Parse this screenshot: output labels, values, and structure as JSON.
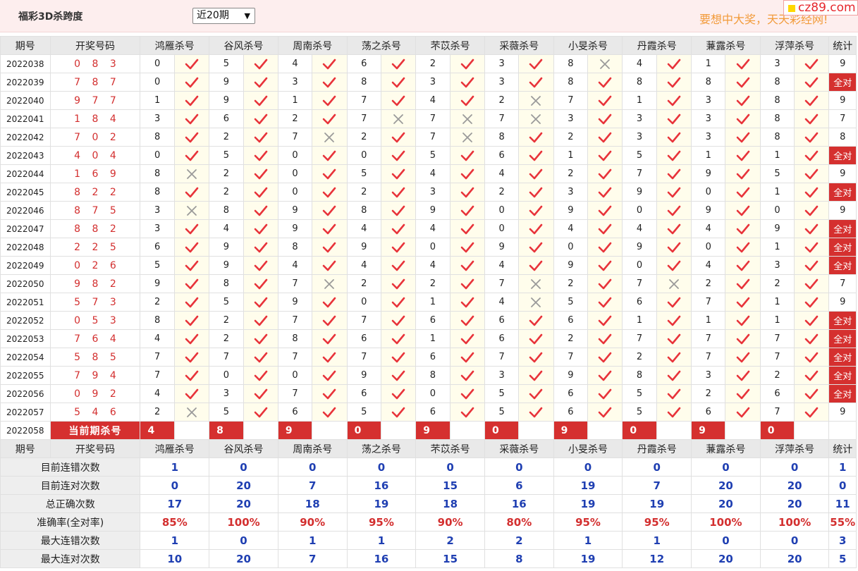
{
  "header": {
    "title": "福彩3D杀跨度",
    "period_select": "近20期",
    "slogan": "要想中大奖，天天彩经网!",
    "site_badge": "cz89.com"
  },
  "table": {
    "headers": [
      "期号",
      "开奖号码",
      "鸿雁杀号",
      "谷风杀号",
      "周南杀号",
      "荡之杀号",
      "芣苡杀号",
      "采薇杀号",
      "小旻杀号",
      "丹霞杀号",
      "蒹露杀号",
      "浮萍杀号",
      "统计"
    ],
    "all_correct_label": "全对",
    "rows": [
      {
        "period": "2022038",
        "draw": "0 8 3",
        "picks": [
          [
            0,
            1
          ],
          [
            5,
            1
          ],
          [
            4,
            1
          ],
          [
            6,
            1
          ],
          [
            2,
            1
          ],
          [
            3,
            1
          ],
          [
            8,
            0
          ],
          [
            4,
            1
          ],
          [
            1,
            1
          ],
          [
            3,
            1
          ]
        ],
        "stat": "9"
      },
      {
        "period": "2022039",
        "draw": "7 8 7",
        "picks": [
          [
            0,
            1
          ],
          [
            9,
            1
          ],
          [
            3,
            1
          ],
          [
            8,
            1
          ],
          [
            3,
            1
          ],
          [
            3,
            1
          ],
          [
            8,
            1
          ],
          [
            8,
            1
          ],
          [
            8,
            1
          ],
          [
            8,
            1
          ]
        ],
        "stat": "全对"
      },
      {
        "period": "2022040",
        "draw": "9 7 7",
        "picks": [
          [
            1,
            1
          ],
          [
            9,
            1
          ],
          [
            1,
            1
          ],
          [
            7,
            1
          ],
          [
            4,
            1
          ],
          [
            2,
            0
          ],
          [
            7,
            1
          ],
          [
            1,
            1
          ],
          [
            3,
            1
          ],
          [
            8,
            1
          ]
        ],
        "stat": "9"
      },
      {
        "period": "2022041",
        "draw": "1 8 4",
        "picks": [
          [
            3,
            1
          ],
          [
            6,
            1
          ],
          [
            2,
            1
          ],
          [
            7,
            0
          ],
          [
            7,
            0
          ],
          [
            7,
            0
          ],
          [
            3,
            1
          ],
          [
            3,
            1
          ],
          [
            3,
            1
          ],
          [
            8,
            1
          ]
        ],
        "stat": "7"
      },
      {
        "period": "2022042",
        "draw": "7 0 2",
        "picks": [
          [
            8,
            1
          ],
          [
            2,
            1
          ],
          [
            7,
            0
          ],
          [
            2,
            1
          ],
          [
            7,
            0
          ],
          [
            8,
            1
          ],
          [
            2,
            1
          ],
          [
            3,
            1
          ],
          [
            3,
            1
          ],
          [
            8,
            1
          ]
        ],
        "stat": "8"
      },
      {
        "period": "2022043",
        "draw": "4 0 4",
        "picks": [
          [
            0,
            1
          ],
          [
            5,
            1
          ],
          [
            0,
            1
          ],
          [
            0,
            1
          ],
          [
            5,
            1
          ],
          [
            6,
            1
          ],
          [
            1,
            1
          ],
          [
            5,
            1
          ],
          [
            1,
            1
          ],
          [
            1,
            1
          ]
        ],
        "stat": "全对"
      },
      {
        "period": "2022044",
        "draw": "1 6 9",
        "picks": [
          [
            8,
            0
          ],
          [
            2,
            1
          ],
          [
            0,
            1
          ],
          [
            5,
            1
          ],
          [
            4,
            1
          ],
          [
            4,
            1
          ],
          [
            2,
            1
          ],
          [
            7,
            1
          ],
          [
            9,
            1
          ],
          [
            5,
            1
          ]
        ],
        "stat": "9"
      },
      {
        "period": "2022045",
        "draw": "8 2 2",
        "picks": [
          [
            8,
            1
          ],
          [
            2,
            1
          ],
          [
            0,
            1
          ],
          [
            2,
            1
          ],
          [
            3,
            1
          ],
          [
            2,
            1
          ],
          [
            3,
            1
          ],
          [
            9,
            1
          ],
          [
            0,
            1
          ],
          [
            1,
            1
          ]
        ],
        "stat": "全对"
      },
      {
        "period": "2022046",
        "draw": "8 7 5",
        "picks": [
          [
            3,
            0
          ],
          [
            8,
            1
          ],
          [
            9,
            1
          ],
          [
            8,
            1
          ],
          [
            9,
            1
          ],
          [
            0,
            1
          ],
          [
            9,
            1
          ],
          [
            0,
            1
          ],
          [
            9,
            1
          ],
          [
            0,
            1
          ]
        ],
        "stat": "9"
      },
      {
        "period": "2022047",
        "draw": "8 8 2",
        "picks": [
          [
            3,
            1
          ],
          [
            4,
            1
          ],
          [
            9,
            1
          ],
          [
            4,
            1
          ],
          [
            4,
            1
          ],
          [
            0,
            1
          ],
          [
            4,
            1
          ],
          [
            4,
            1
          ],
          [
            4,
            1
          ],
          [
            9,
            1
          ]
        ],
        "stat": "全对"
      },
      {
        "period": "2022048",
        "draw": "2 2 5",
        "picks": [
          [
            6,
            1
          ],
          [
            9,
            1
          ],
          [
            8,
            1
          ],
          [
            9,
            1
          ],
          [
            0,
            1
          ],
          [
            9,
            1
          ],
          [
            0,
            1
          ],
          [
            9,
            1
          ],
          [
            0,
            1
          ],
          [
            1,
            1
          ]
        ],
        "stat": "全对"
      },
      {
        "period": "2022049",
        "draw": "0 2 6",
        "picks": [
          [
            5,
            1
          ],
          [
            9,
            1
          ],
          [
            4,
            1
          ],
          [
            4,
            1
          ],
          [
            4,
            1
          ],
          [
            4,
            1
          ],
          [
            9,
            1
          ],
          [
            0,
            1
          ],
          [
            4,
            1
          ],
          [
            3,
            1
          ]
        ],
        "stat": "全对"
      },
      {
        "period": "2022050",
        "draw": "9 8 2",
        "picks": [
          [
            9,
            1
          ],
          [
            8,
            1
          ],
          [
            7,
            0
          ],
          [
            2,
            1
          ],
          [
            2,
            1
          ],
          [
            7,
            0
          ],
          [
            2,
            1
          ],
          [
            7,
            0
          ],
          [
            2,
            1
          ],
          [
            2,
            1
          ]
        ],
        "stat": "7"
      },
      {
        "period": "2022051",
        "draw": "5 7 3",
        "picks": [
          [
            2,
            1
          ],
          [
            5,
            1
          ],
          [
            9,
            1
          ],
          [
            0,
            1
          ],
          [
            1,
            1
          ],
          [
            4,
            0
          ],
          [
            5,
            1
          ],
          [
            6,
            1
          ],
          [
            7,
            1
          ],
          [
            1,
            1
          ]
        ],
        "stat": "9"
      },
      {
        "period": "2022052",
        "draw": "0 5 3",
        "picks": [
          [
            8,
            1
          ],
          [
            2,
            1
          ],
          [
            7,
            1
          ],
          [
            7,
            1
          ],
          [
            6,
            1
          ],
          [
            6,
            1
          ],
          [
            6,
            1
          ],
          [
            1,
            1
          ],
          [
            1,
            1
          ],
          [
            1,
            1
          ]
        ],
        "stat": "全对"
      },
      {
        "period": "2022053",
        "draw": "7 6 4",
        "picks": [
          [
            4,
            1
          ],
          [
            2,
            1
          ],
          [
            8,
            1
          ],
          [
            6,
            1
          ],
          [
            1,
            1
          ],
          [
            6,
            1
          ],
          [
            2,
            1
          ],
          [
            7,
            1
          ],
          [
            7,
            1
          ],
          [
            7,
            1
          ]
        ],
        "stat": "全对"
      },
      {
        "period": "2022054",
        "draw": "5 8 5",
        "picks": [
          [
            7,
            1
          ],
          [
            7,
            1
          ],
          [
            7,
            1
          ],
          [
            7,
            1
          ],
          [
            6,
            1
          ],
          [
            7,
            1
          ],
          [
            7,
            1
          ],
          [
            2,
            1
          ],
          [
            7,
            1
          ],
          [
            7,
            1
          ]
        ],
        "stat": "全对"
      },
      {
        "period": "2022055",
        "draw": "7 9 4",
        "picks": [
          [
            7,
            1
          ],
          [
            0,
            1
          ],
          [
            0,
            1
          ],
          [
            9,
            1
          ],
          [
            8,
            1
          ],
          [
            3,
            1
          ],
          [
            9,
            1
          ],
          [
            8,
            1
          ],
          [
            3,
            1
          ],
          [
            2,
            1
          ]
        ],
        "stat": "全对"
      },
      {
        "period": "2022056",
        "draw": "0 9 2",
        "picks": [
          [
            4,
            1
          ],
          [
            3,
            1
          ],
          [
            7,
            1
          ],
          [
            6,
            1
          ],
          [
            0,
            1
          ],
          [
            5,
            1
          ],
          [
            6,
            1
          ],
          [
            5,
            1
          ],
          [
            2,
            1
          ],
          [
            6,
            1
          ]
        ],
        "stat": "全对"
      },
      {
        "period": "2022057",
        "draw": "5 4 6",
        "picks": [
          [
            2,
            0
          ],
          [
            5,
            1
          ],
          [
            6,
            1
          ],
          [
            5,
            1
          ],
          [
            6,
            1
          ],
          [
            5,
            1
          ],
          [
            6,
            1
          ],
          [
            5,
            1
          ],
          [
            6,
            1
          ],
          [
            7,
            1
          ]
        ],
        "stat": "9"
      }
    ],
    "current": {
      "period": "2022058",
      "label": "当前期杀号",
      "kills": [
        "4",
        "8",
        "9",
        "0",
        "9",
        "0",
        "9",
        "0",
        "9",
        "0"
      ]
    },
    "summary": [
      {
        "label": "目前连错次数",
        "values": [
          "1",
          "0",
          "0",
          "0",
          "0",
          "0",
          "0",
          "0",
          "0",
          "0",
          "1"
        ],
        "red": false
      },
      {
        "label": "目前连对次数",
        "values": [
          "0",
          "20",
          "7",
          "16",
          "15",
          "6",
          "19",
          "7",
          "20",
          "20",
          "0"
        ],
        "red": false
      },
      {
        "label": "总正确次数",
        "values": [
          "17",
          "20",
          "18",
          "19",
          "18",
          "16",
          "19",
          "19",
          "20",
          "20",
          "11"
        ],
        "red": false
      },
      {
        "label": "准确率(全对率)",
        "values": [
          "85%",
          "100%",
          "90%",
          "95%",
          "90%",
          "80%",
          "95%",
          "95%",
          "100%",
          "100%",
          "55%"
        ],
        "red": true
      },
      {
        "label": "最大连错次数",
        "values": [
          "1",
          "0",
          "1",
          "1",
          "2",
          "2",
          "1",
          "1",
          "0",
          "0",
          "3"
        ],
        "red": false
      },
      {
        "label": "最大连对次数",
        "values": [
          "10",
          "20",
          "7",
          "16",
          "15",
          "8",
          "19",
          "12",
          "20",
          "20",
          "5"
        ],
        "red": false
      }
    ]
  },
  "colors": {
    "accent_red": "#d5302f",
    "check_red": "#e8333a",
    "cross_gray": "#9a9a9a",
    "summary_blue": "#1f3fb2",
    "slogan_orange": "#f29b3a"
  },
  "icons": {
    "correct": "check-icon",
    "wrong": "cross-icon"
  }
}
